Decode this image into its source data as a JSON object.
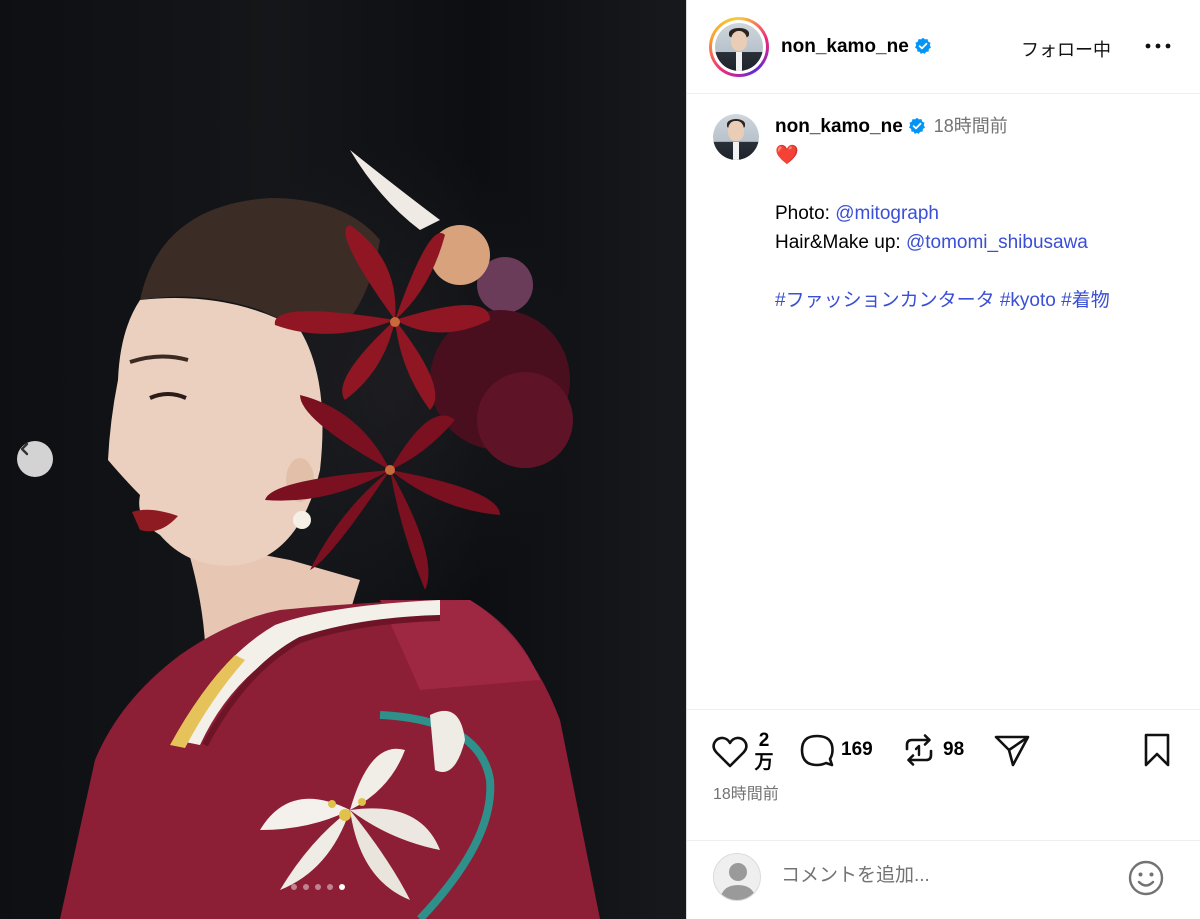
{
  "post": {
    "username": "non_kamo_ne",
    "follow_label": "フォロー中",
    "time_ago": "18時間前",
    "caption": {
      "emoji": "❤️",
      "photo_label": "Photo: ",
      "photo_handle": "@mitograph",
      "hair_label": "Hair&Make up: ",
      "hair_handle": "@tomomi_shibusawa",
      "hashtags": [
        "#ファッションカンタータ",
        "#kyoto",
        "#着物"
      ]
    },
    "likes_count_top": "2",
    "likes_count_bottom": "万",
    "comments_count": "169",
    "reposts_count": "98",
    "posted_time": "18時間前"
  },
  "carousel": {
    "slide_count": 5,
    "active_slide": 5
  },
  "comment_input": {
    "placeholder": "コメントを追加..."
  },
  "colors": {
    "link": "#3a4fd6",
    "verified": "#0095f6",
    "muted": "#737373",
    "kimono": "#8c1e36"
  },
  "icons": [
    "chevron-left-icon",
    "verified-badge-icon",
    "more-icon",
    "heart-icon",
    "comment-icon",
    "repost-icon",
    "share-icon",
    "bookmark-icon",
    "emoji-icon",
    "user-icon"
  ]
}
